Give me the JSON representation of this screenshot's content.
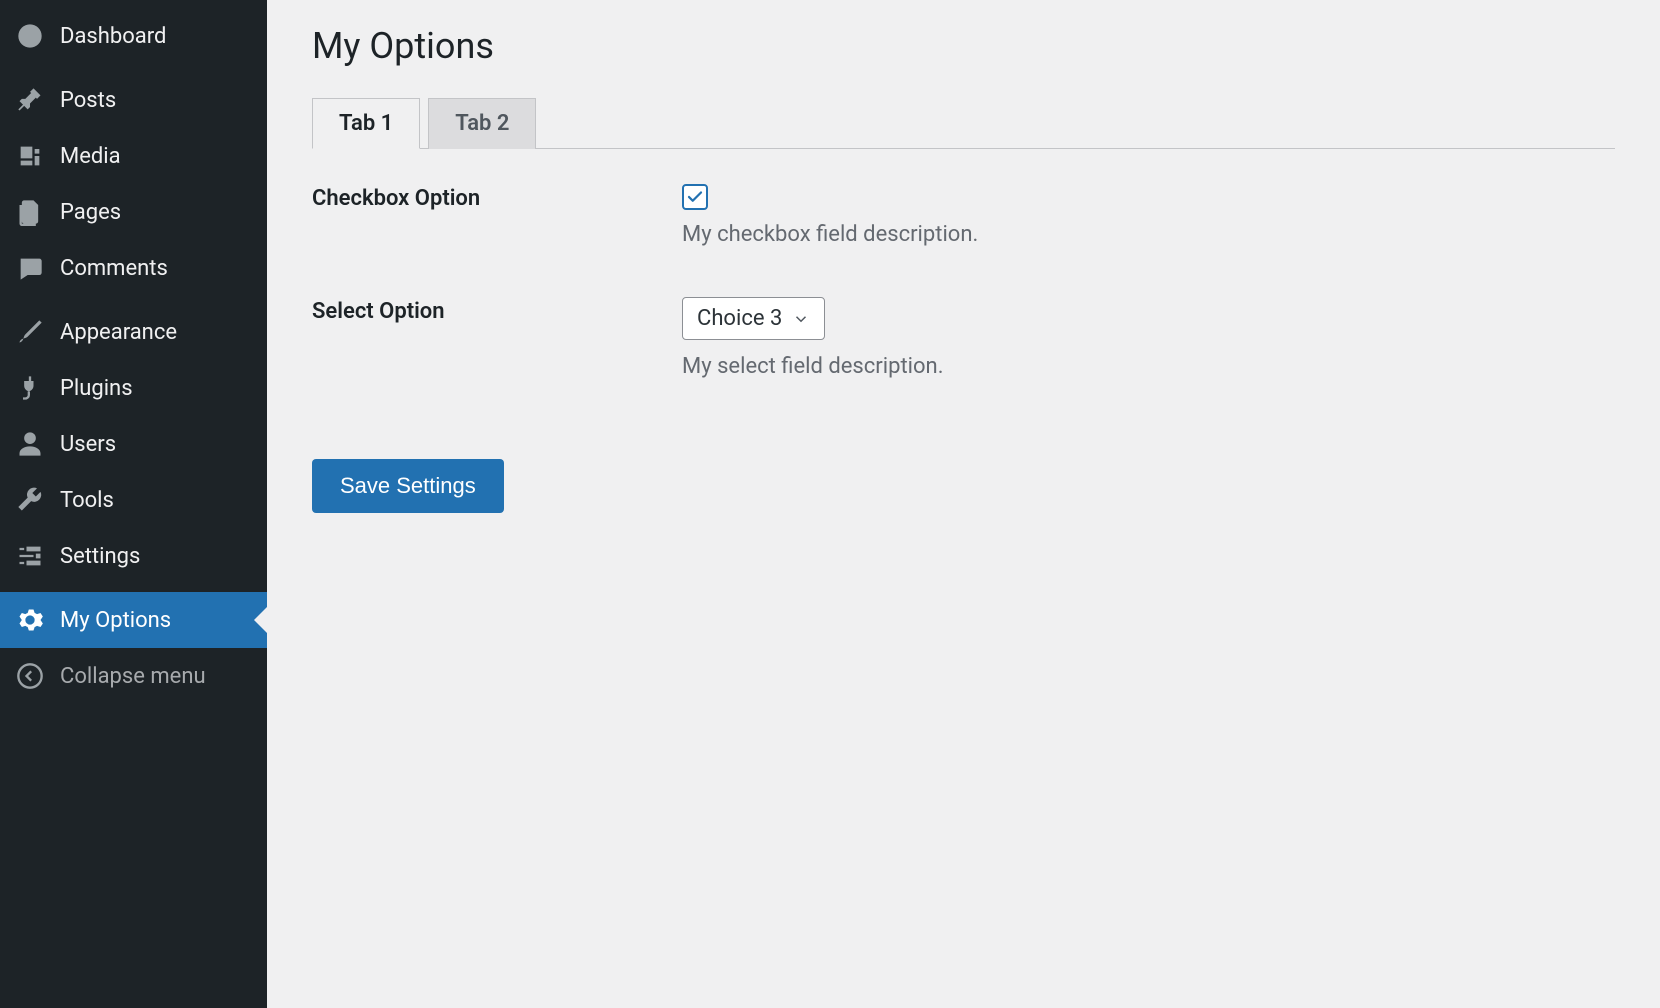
{
  "sidebar": {
    "items": [
      {
        "label": "Dashboard",
        "icon": "dashboard"
      },
      {
        "label": "Posts",
        "icon": "pin"
      },
      {
        "label": "Media",
        "icon": "media"
      },
      {
        "label": "Pages",
        "icon": "pages"
      },
      {
        "label": "Comments",
        "icon": "comment"
      },
      {
        "label": "Appearance",
        "icon": "brush"
      },
      {
        "label": "Plugins",
        "icon": "plug"
      },
      {
        "label": "Users",
        "icon": "user"
      },
      {
        "label": "Tools",
        "icon": "wrench"
      },
      {
        "label": "Settings",
        "icon": "sliders"
      },
      {
        "label": "My Options",
        "icon": "gear"
      }
    ],
    "collapse_label": "Collapse menu"
  },
  "main": {
    "title": "My Options",
    "tabs": [
      {
        "label": "Tab 1",
        "active": true
      },
      {
        "label": "Tab 2",
        "active": false
      }
    ],
    "fields": {
      "checkbox": {
        "label": "Checkbox Option",
        "checked": true,
        "description": "My checkbox field description."
      },
      "select": {
        "label": "Select Option",
        "value": "Choice 3",
        "description": "My select field description."
      }
    },
    "save_label": "Save Settings"
  },
  "colors": {
    "primary": "#2271b1",
    "sidebar_bg": "#1d2327",
    "body_bg": "#f0f0f1"
  }
}
